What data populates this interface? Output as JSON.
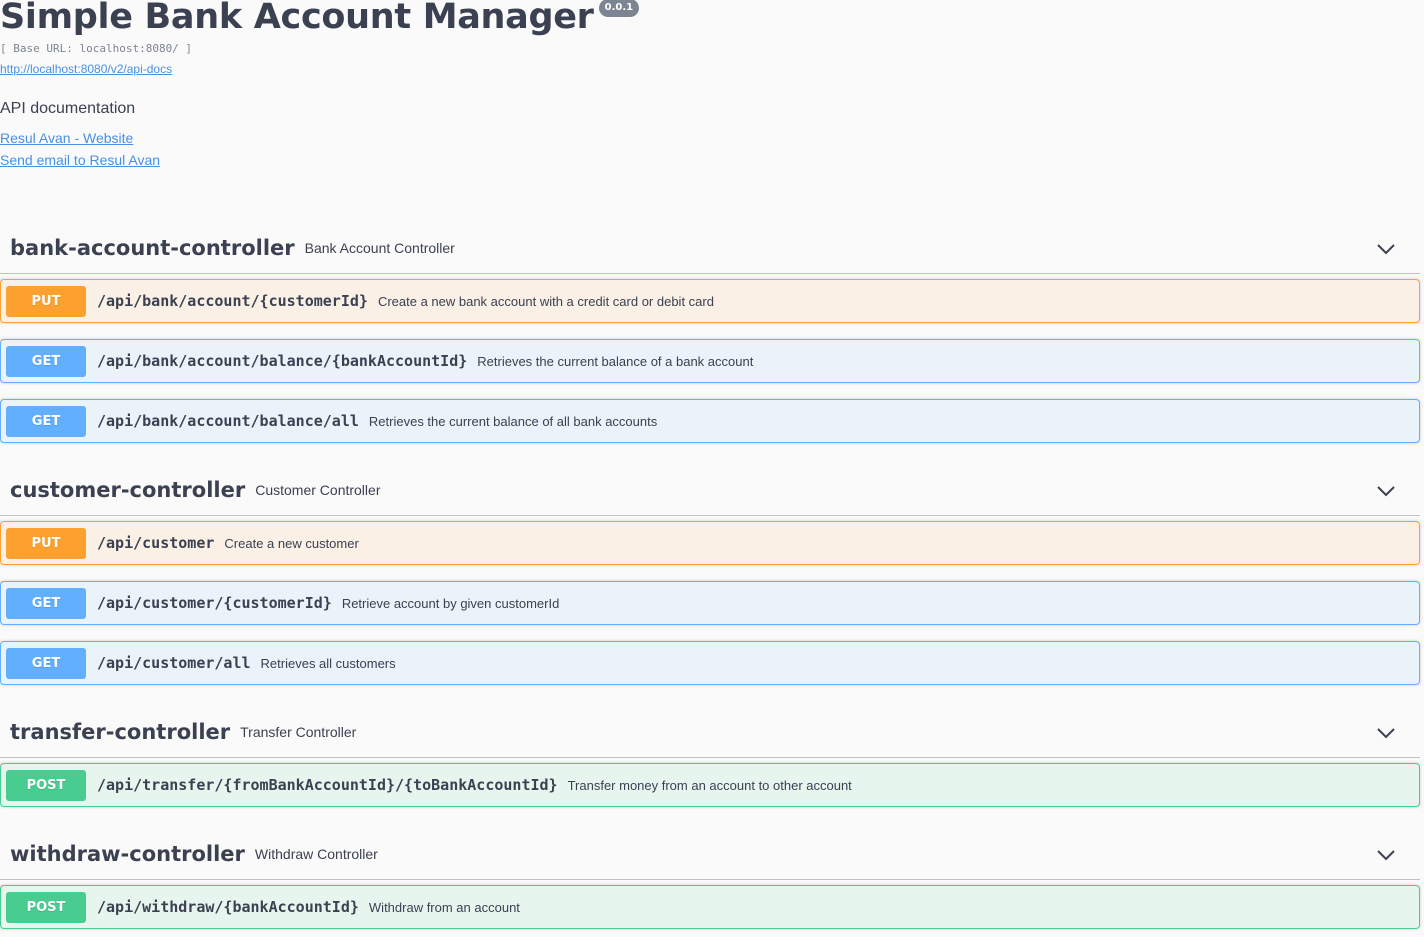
{
  "info": {
    "title": "Simple Bank Account Manager",
    "version": "0.0.1",
    "base_url": "[ Base URL: localhost:8080/ ]",
    "docs_url": "http://localhost:8080/v2/api-docs",
    "description": "API documentation",
    "contact_website": "Resul Avan - Website",
    "contact_email": "Send email to Resul Avan"
  },
  "tags": [
    {
      "name": "bank-account-controller",
      "description": "Bank Account Controller",
      "operations": [
        {
          "method": "PUT",
          "path": "/api/bank/account/{customerId}",
          "summary": "Create a new bank account with a credit card or debit card"
        },
        {
          "method": "GET",
          "path": "/api/bank/account/balance/{bankAccountId}",
          "summary": "Retrieves the current balance of a bank account"
        },
        {
          "method": "GET",
          "path": "/api/bank/account/balance/all",
          "summary": "Retrieves the current balance of all bank accounts"
        }
      ]
    },
    {
      "name": "customer-controller",
      "description": "Customer Controller",
      "operations": [
        {
          "method": "PUT",
          "path": "/api/customer",
          "summary": "Create a new customer"
        },
        {
          "method": "GET",
          "path": "/api/customer/{customerId}",
          "summary": "Retrieve account by given customerId"
        },
        {
          "method": "GET",
          "path": "/api/customer/all",
          "summary": "Retrieves all customers"
        }
      ]
    },
    {
      "name": "transfer-controller",
      "description": "Transfer Controller",
      "operations": [
        {
          "method": "POST",
          "path": "/api/transfer/{fromBankAccountId}/{toBankAccountId}",
          "summary": "Transfer money from an account to other account"
        }
      ]
    },
    {
      "name": "withdraw-controller",
      "description": "Withdraw Controller",
      "operations": [
        {
          "method": "POST",
          "path": "/api/withdraw/{bankAccountId}",
          "summary": "Withdraw from an account"
        }
      ]
    }
  ],
  "icons": {
    "tag_toggle": "chevron-down-icon"
  },
  "colors": {
    "put": "#fca130",
    "get": "#61affe",
    "post": "#49cc90",
    "link": "#4990e2",
    "text": "#3b4151"
  }
}
